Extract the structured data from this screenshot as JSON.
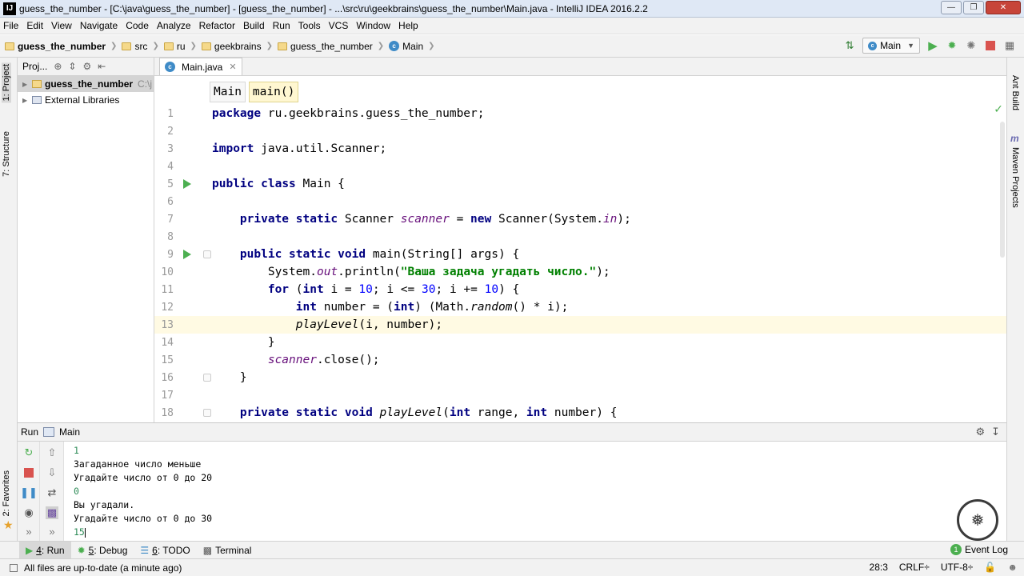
{
  "window": {
    "title": "guess_the_number - [C:\\java\\guess_the_number] - [guess_the_number] - ...\\src\\ru\\geekbrains\\guess_the_number\\Main.java - IntelliJ IDEA 2016.2.2"
  },
  "menu": [
    "File",
    "Edit",
    "View",
    "Navigate",
    "Code",
    "Analyze",
    "Refactor",
    "Build",
    "Run",
    "Tools",
    "VCS",
    "Window",
    "Help"
  ],
  "breadcrumbs": [
    "guess_the_number",
    "src",
    "ru",
    "geekbrains",
    "guess_the_number",
    "Main"
  ],
  "run_config": "Main",
  "left_tabs": {
    "project": "1: Project",
    "structure": "7: Structure",
    "favorites": "2: Favorites"
  },
  "right_tabs": {
    "ant": "Ant Build",
    "maven": "Maven Projects"
  },
  "project_panel": {
    "header": "Proj...",
    "tree": [
      {
        "label": "guess_the_number",
        "suffix": "C:\\j"
      },
      {
        "label": "External Libraries",
        "suffix": ""
      }
    ]
  },
  "editor": {
    "tab": "Main.java",
    "crumbs": [
      "Main",
      "main()"
    ],
    "current_line": 13,
    "lines": [
      {
        "n": "1",
        "text": "package ru.geekbrains.guess_the_number;"
      },
      {
        "n": "2",
        "text": ""
      },
      {
        "n": "3",
        "text": "import java.util.Scanner;"
      },
      {
        "n": "4",
        "text": ""
      },
      {
        "n": "5",
        "text": "public class Main {"
      },
      {
        "n": "6",
        "text": ""
      },
      {
        "n": "7",
        "text": "    private static Scanner scanner = new Scanner(System.in);"
      },
      {
        "n": "8",
        "text": ""
      },
      {
        "n": "9",
        "text": "    public static void main(String[] args) {"
      },
      {
        "n": "10",
        "text": "        System.out.println(\"Ваша задача угадать число.\");"
      },
      {
        "n": "11",
        "text": "        for (int i = 10; i <= 30; i += 10) {"
      },
      {
        "n": "12",
        "text": "            int number = (int) (Math.random() * i);"
      },
      {
        "n": "13",
        "text": "            playLevel(i, number);"
      },
      {
        "n": "14",
        "text": "        }"
      },
      {
        "n": "15",
        "text": "        scanner.close();"
      },
      {
        "n": "16",
        "text": "    }"
      },
      {
        "n": "17",
        "text": ""
      },
      {
        "n": "18",
        "text": "    private static void playLevel(int range, int number) {"
      }
    ]
  },
  "run_panel": {
    "label": "Run",
    "config": "Main",
    "console": [
      {
        "text": "1",
        "type": "in"
      },
      {
        "text": "Загаданное число меньше",
        "type": "out"
      },
      {
        "text": "Угадайте число от 0 до 20",
        "type": "out"
      },
      {
        "text": "0",
        "type": "in"
      },
      {
        "text": "Вы угадали.",
        "type": "out"
      },
      {
        "text": "Угадайте число от 0 до 30",
        "type": "out"
      },
      {
        "text": "15",
        "type": "in"
      }
    ]
  },
  "tool_windows": [
    {
      "num": "4",
      "label": ": Run"
    },
    {
      "num": "5",
      "label": ": Debug"
    },
    {
      "num": "6",
      "label": ": TODO"
    },
    {
      "num": "",
      "label": "Terminal"
    }
  ],
  "event_log": {
    "label": "Event Log",
    "count": "1"
  },
  "status": {
    "message": "All files are up-to-date (a minute ago)",
    "position": "28:3",
    "line_sep": "CRLF÷",
    "encoding": "UTF-8÷"
  },
  "colors": {
    "keyword": "#000080",
    "string": "#008000",
    "field": "#660e7a",
    "number": "#0000ff",
    "run_green": "#4caf50"
  }
}
